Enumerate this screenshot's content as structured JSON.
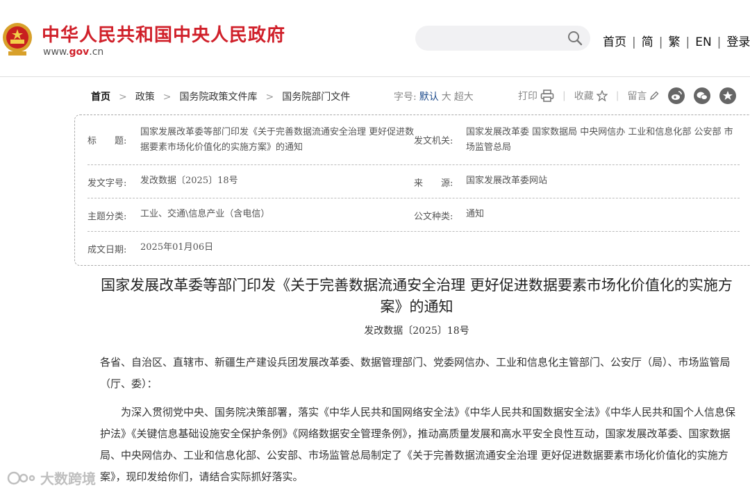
{
  "header": {
    "site_title": "中华人民共和国中央人民政府",
    "site_url_pre": "www.",
    "site_url_mid": "gov",
    "site_url_post": ".cn",
    "search_placeholder": "",
    "nav": [
      "首页",
      "简",
      "繁",
      "EN",
      "登录"
    ],
    "accent": "#d0202a"
  },
  "breadcrumb": [
    "首页",
    "政策",
    "国务院政策文件库",
    "国务院部门文件"
  ],
  "font_size": {
    "label": "字号:",
    "options": [
      "默认",
      "大",
      "超大"
    ],
    "selected": "默认"
  },
  "tools": {
    "print": "打印",
    "favorite": "收藏",
    "comment": "留言"
  },
  "share_icons": [
    "weibo-icon",
    "wechat-icon",
    "favorite-star-icon"
  ],
  "info": {
    "title_label": "标　　题:",
    "title_value": "国家发展改革委等部门印发《关于完善数据流通安全治理 更好促进数据要素市场化价值化的实施方案》的通知",
    "issuer_label": "发文机关:",
    "issuer_value": "国家发展改革委 国家数据局 中央网信办 工业和信息化部 公安部 市场监管总局",
    "docno_label": "发文字号:",
    "docno_value": "发改数据〔2025〕18号",
    "source_label": "来　　源:",
    "source_value": "国家发展改革委网站",
    "topic_label": "主题分类:",
    "topic_value": "工业、交通\\信息产业（含电信）",
    "type_label": "公文种类:",
    "type_value": "通知",
    "date_label": "成文日期:",
    "date_value": "2025年01月06日"
  },
  "article": {
    "title": "国家发展改革委等部门印发《关于完善数据流通安全治理 更好促进数据要素市场化价值化的实施方案》的通知",
    "doc_no": "发改数据〔2025〕18号",
    "salutation": "各省、自治区、直辖市、新疆生产建设兵团发展改革委、数据管理部门、党委网信办、工业和信息化主管部门、公安厅（局）、市场监管局（厅、委）：",
    "body": "为深入贯彻党中央、国务院决策部署，落实《中华人民共和国网络安全法》《中华人民共和国数据安全法》《中华人民共和国个人信息保护法》《关键信息基础设施安全保护条例》《网络数据安全管理条例》，推动高质量发展和高水平安全良性互动，国家发展改革委、国家数据局、中央网信办、工业和信息化部、公安部、市场监管总局制定了《关于完善数据流通安全治理 更好促进数据要素市场化价值化的实施方案》，现印发给你们，请结合实际抓好落实。"
  },
  "watermark": "大数跨境"
}
